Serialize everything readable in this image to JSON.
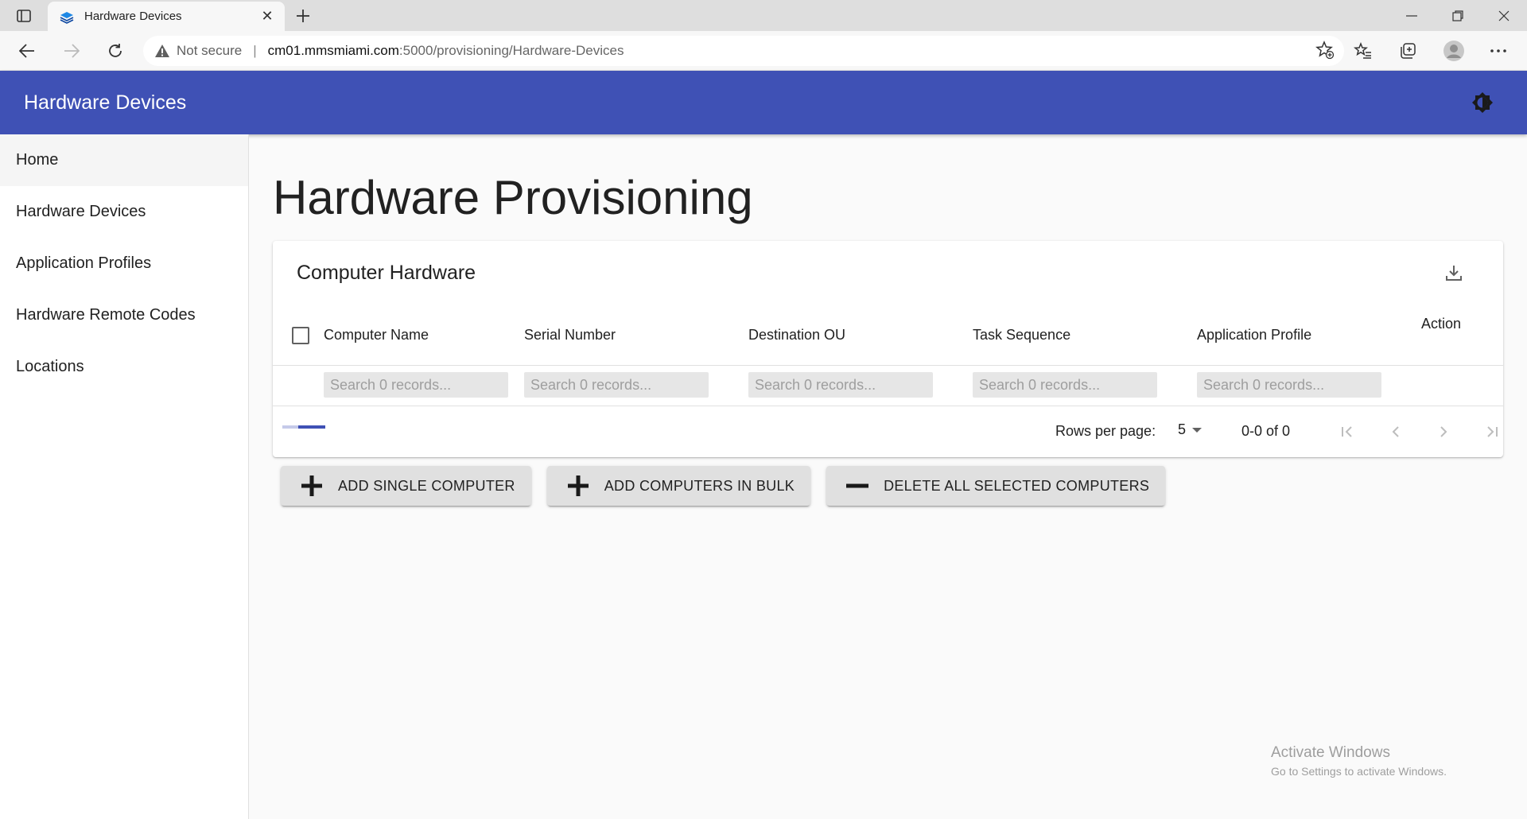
{
  "browser": {
    "tab_title": "Hardware Devices",
    "security_label": "Not secure",
    "url_host": "cm01.mmsmiami.com",
    "url_rest": ":5000/provisioning/Hardware-Devices"
  },
  "appbar": {
    "title": "Hardware Devices"
  },
  "sidebar": {
    "items": [
      {
        "label": "Home"
      },
      {
        "label": "Hardware Devices"
      },
      {
        "label": "Application Profiles"
      },
      {
        "label": "Hardware Remote Codes"
      },
      {
        "label": "Locations"
      }
    ]
  },
  "main": {
    "title": "Hardware Provisioning",
    "card": {
      "title": "Computer Hardware",
      "columns": [
        {
          "label": "Computer Name",
          "placeholder": "Search 0 records..."
        },
        {
          "label": "Serial Number",
          "placeholder": "Search 0 records..."
        },
        {
          "label": "Destination OU",
          "placeholder": "Search 0 records..."
        },
        {
          "label": "Task Sequence",
          "placeholder": "Search 0 records..."
        },
        {
          "label": "Application Profile",
          "placeholder": "Search 0 records..."
        },
        {
          "label": "Action"
        }
      ],
      "pagination": {
        "rows_per_page_label": "Rows per page:",
        "rows_per_page": "5",
        "range": "0-0 of 0"
      }
    },
    "buttons": {
      "add_single": "ADD SINGLE COMPUTER",
      "add_bulk": "ADD COMPUTERS IN BULK",
      "delete_selected": "DELETE ALL SELECTED COMPUTERS"
    }
  },
  "watermark": {
    "line1": "Activate Windows",
    "line2": "Go to Settings to activate Windows."
  },
  "colors": {
    "primary": "#3f51b5",
    "button_bg": "#e0e0e0"
  }
}
